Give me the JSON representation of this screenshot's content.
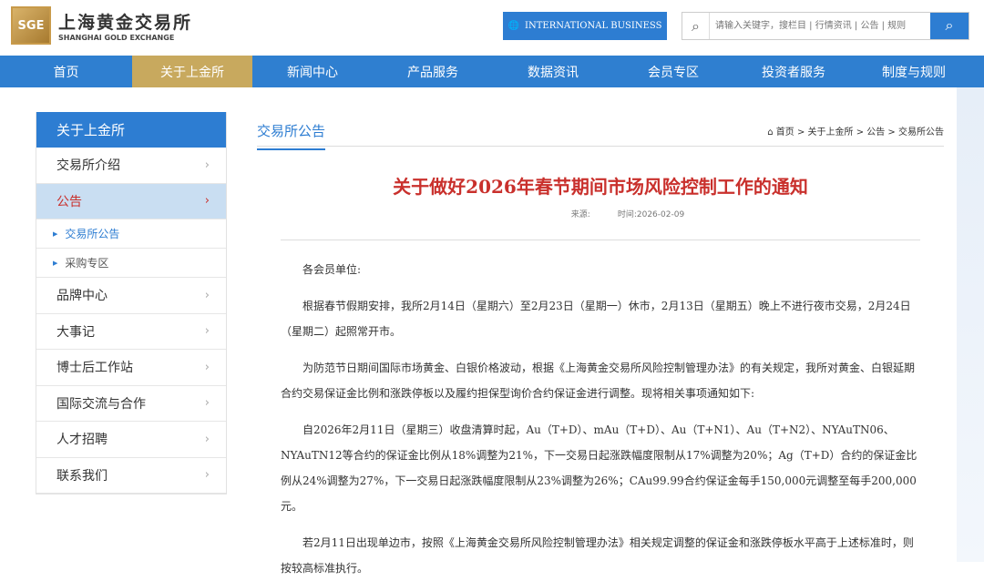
{
  "header": {
    "logo_cn": "上海黄金交易所",
    "logo_en": "SHANGHAI GOLD EXCHANGE",
    "logo_mark": "SGE",
    "intl_button": "INTERNATIONAL BUSINESS",
    "search_placeholder": "请输入关键字，搜栏目 | 行情资讯 | 公告 | 规则"
  },
  "nav": [
    "首页",
    "关于上金所",
    "新闻中心",
    "产品服务",
    "数据资讯",
    "会员专区",
    "投资者服务",
    "制度与规则"
  ],
  "sidebar": {
    "title": "关于上金所",
    "items": [
      "交易所介绍",
      "公告"
    ],
    "subitems": [
      "交易所公告",
      "采购专区"
    ],
    "items2": [
      "品牌中心",
      "大事记",
      "博士后工作站",
      "国际交流与合作",
      "人才招聘",
      "联系我们"
    ]
  },
  "main": {
    "section_title": "交易所公告",
    "breadcrumb": "首页 > 关于上金所 > 公告 > 交易所公告",
    "article_title": "关于做好2026年春节期间市场风险控制工作的通知",
    "source_label": "来源:",
    "time_label": "时间:2026-02-09",
    "paragraphs": [
      "各会员单位:",
      "根据春节假期安排，我所2月14日（星期六）至2月23日（星期一）休市，2月13日（星期五）晚上不进行夜市交易，2月24日（星期二）起照常开市。",
      "为防范节日期间国际市场黄金、白银价格波动，根据《上海黄金交易所风险控制管理办法》的有关规定，我所对黄金、白银延期合约交易保证金比例和涨跌停板以及履约担保型询价合约保证金进行调整。现将相关事项通知如下:",
      "自2026年2月11日（星期三）收盘清算时起，Au（T+D）、mAu（T+D）、Au（T+N1）、Au（T+N2）、NYAuTN06、NYAuTN12等合约的保证金比例从18%调整为21%，下一交易日起涨跌幅度限制从17%调整为20%；Ag（T+D）合约的保证金比例从24%调整为27%，下一交易日起涨跌幅度限制从23%调整为26%；CAu99.99合约保证金每手150,000元调整至每手200,000元。",
      "若2月11日出现单边市，按照《上海黄金交易所风险控制管理办法》相关规定调整的保证金和涨跌停板水平高于上述标准时，则按较高标准执行。"
    ]
  }
}
